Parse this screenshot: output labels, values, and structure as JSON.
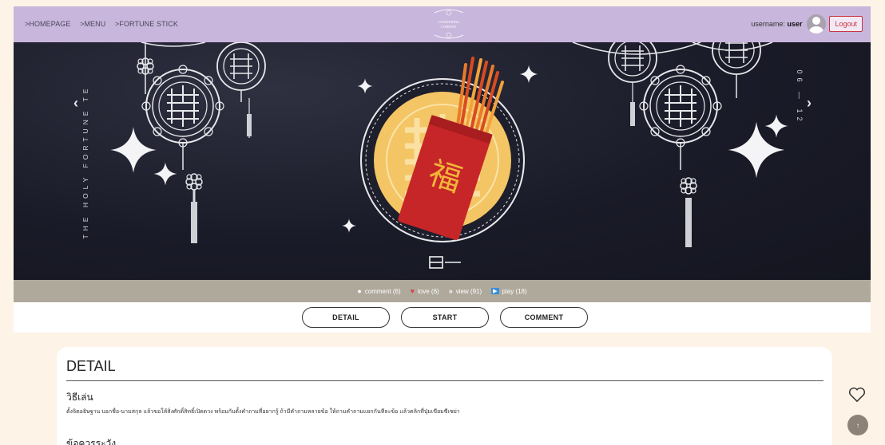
{
  "nav": {
    "breadcrumbs": [
      ">HOMEPAGE",
      ">MENU",
      ">FORTUNE STICK"
    ],
    "logo_text": "GOODTHING COMPANY",
    "username_label": "username:",
    "username": "user",
    "logout_label": "Logout"
  },
  "banner": {
    "vertical_title": "THE HOLY FORTUNE TE",
    "vertical_date": "06 — 12",
    "prev_icon": "chevron-left-icon",
    "next_icon": "chevron-right-icon",
    "slide_indicator": "slide-indicator"
  },
  "stats": {
    "comment": "comment (6)",
    "love": "love (6)",
    "view": "view (91)",
    "play": "play (18)"
  },
  "tabs": {
    "detail": "DETAIL",
    "start": "START",
    "comment": "COMMENT"
  },
  "detail": {
    "title": "DETAIL",
    "how_to_play_heading": "วิธีเล่น",
    "how_to_play_body": "ตั้งจิตอธิษฐาน บอกชื่อ-นามสกุล แล้วขอให้สิ่งศักดิ์สิทธิ์เปิดดวง พร้อมกับตั้งคำถามที่อยากรู้ ถ้ามีคำถามหลายข้อ ให้ถามคำถามแยกกันทีละข้อ แล้วคลิกที่ปุ่มเขียมซีเซย่า",
    "caution_heading": "ข้อควรระวัง"
  },
  "colors": {
    "nav_bg": "#c8b6dc",
    "banner_bg": "#1a1b28",
    "stats_bg": "#aea99b",
    "page_bg": "#fdf3e6",
    "logout": "#c8343f"
  }
}
